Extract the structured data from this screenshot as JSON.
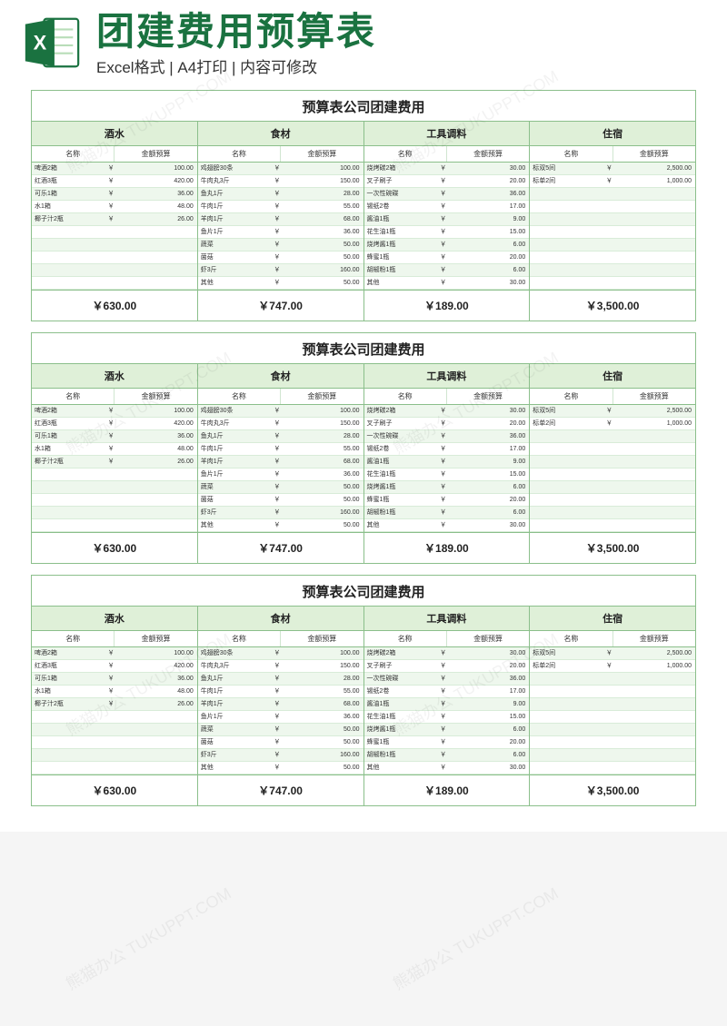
{
  "header": {
    "title": "团建费用预算表",
    "subtitle": "Excel格式 | A4打印 | 内容可修改"
  },
  "watermark_text": "熊猫办公 TUKUPPT.COM",
  "sheet_title": "预算表公司团建费用",
  "col_sub_headers": {
    "name": "名称",
    "budget": "金额预算"
  },
  "currency": "￥",
  "categories": [
    {
      "label": "酒水",
      "total": "￥630.00",
      "rows": [
        {
          "name": "啤酒2箱",
          "val": "100.00"
        },
        {
          "name": "红酒3瓶",
          "val": "420.00"
        },
        {
          "name": "可乐1箱",
          "val": "36.00"
        },
        {
          "name": "水1箱",
          "val": "48.00"
        },
        {
          "name": "椰子汁2瓶",
          "val": "26.00"
        },
        {
          "name": "",
          "val": ""
        },
        {
          "name": "",
          "val": ""
        },
        {
          "name": "",
          "val": ""
        },
        {
          "name": "",
          "val": ""
        },
        {
          "name": "",
          "val": ""
        }
      ]
    },
    {
      "label": "食材",
      "total": "￥747.00",
      "rows": [
        {
          "name": "鸡翅膀30条",
          "val": "100.00"
        },
        {
          "name": "牛肉丸3斤",
          "val": "150.00"
        },
        {
          "name": "鱼丸1斤",
          "val": "28.00"
        },
        {
          "name": "牛肉1斤",
          "val": "55.00"
        },
        {
          "name": "羊肉1斤",
          "val": "68.00"
        },
        {
          "name": "鱼片1斤",
          "val": "36.00"
        },
        {
          "name": "蔬菜",
          "val": "50.00"
        },
        {
          "name": "菌菇",
          "val": "50.00"
        },
        {
          "name": "虾3斤",
          "val": "160.00"
        },
        {
          "name": "其他",
          "val": "50.00"
        }
      ]
    },
    {
      "label": "工具调料",
      "total": "￥189.00",
      "rows": [
        {
          "name": "烧烤碳2箱",
          "val": "30.00"
        },
        {
          "name": "叉子刷子",
          "val": "20.00"
        },
        {
          "name": "一次性碗碟",
          "val": "36.00"
        },
        {
          "name": "锡纸2卷",
          "val": "17.00"
        },
        {
          "name": "酱油1瓶",
          "val": "9.00"
        },
        {
          "name": "花生油1瓶",
          "val": "15.00"
        },
        {
          "name": "烧烤酱1瓶",
          "val": "6.00"
        },
        {
          "name": "蜂蜜1瓶",
          "val": "20.00"
        },
        {
          "name": "胡椒粉1瓶",
          "val": "6.00"
        },
        {
          "name": "其他",
          "val": "30.00"
        }
      ]
    },
    {
      "label": "住宿",
      "total": "￥3,500.00",
      "rows": [
        {
          "name": "标双5间",
          "val": "2,500.00"
        },
        {
          "name": "标单2间",
          "val": "1,000.00"
        },
        {
          "name": "",
          "val": ""
        },
        {
          "name": "",
          "val": ""
        },
        {
          "name": "",
          "val": ""
        },
        {
          "name": "",
          "val": ""
        },
        {
          "name": "",
          "val": ""
        },
        {
          "name": "",
          "val": ""
        },
        {
          "name": "",
          "val": ""
        },
        {
          "name": "",
          "val": ""
        }
      ]
    }
  ],
  "chart_data": {
    "type": "table",
    "title": "预算表公司团建费用",
    "sections": [
      {
        "category": "酒水",
        "total": 630.0,
        "items": [
          [
            "啤酒2箱",
            100
          ],
          [
            "红酒3瓶",
            420
          ],
          [
            "可乐1箱",
            36
          ],
          [
            "水1箱",
            48
          ],
          [
            "椰子汁2瓶",
            26
          ]
        ]
      },
      {
        "category": "食材",
        "total": 747.0,
        "items": [
          [
            "鸡翅膀30条",
            100
          ],
          [
            "牛肉丸3斤",
            150
          ],
          [
            "鱼丸1斤",
            28
          ],
          [
            "牛肉1斤",
            55
          ],
          [
            "羊肉1斤",
            68
          ],
          [
            "鱼片1斤",
            36
          ],
          [
            "蔬菜",
            50
          ],
          [
            "菌菇",
            50
          ],
          [
            "虾3斤",
            160
          ],
          [
            "其他",
            50
          ]
        ]
      },
      {
        "category": "工具调料",
        "total": 189.0,
        "items": [
          [
            "烧烤碳2箱",
            30
          ],
          [
            "叉子刷子",
            20
          ],
          [
            "一次性碗碟",
            36
          ],
          [
            "锡纸2卷",
            17
          ],
          [
            "酱油1瓶",
            9
          ],
          [
            "花生油1瓶",
            15
          ],
          [
            "烧烤酱1瓶",
            6
          ],
          [
            "蜂蜜1瓶",
            20
          ],
          [
            "胡椒粉1瓶",
            6
          ],
          [
            "其他",
            30
          ]
        ]
      },
      {
        "category": "住宿",
        "total": 3500.0,
        "items": [
          [
            "标双5间",
            2500
          ],
          [
            "标单2间",
            1000
          ]
        ]
      }
    ]
  }
}
